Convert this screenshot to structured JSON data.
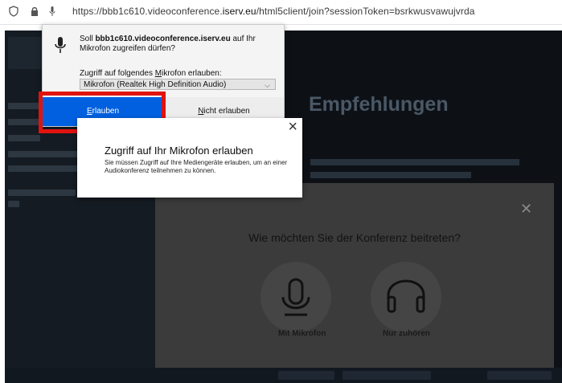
{
  "browser": {
    "url_prefix": "https://bbb1c610.videoconference.",
    "url_domain": "iserv.eu",
    "url_suffix": "/html5client/join?sessionToken=bsrkwusvawujvrda"
  },
  "background": {
    "heading": "Empfehlungen"
  },
  "join_dialog": {
    "title": "Wie möchten Sie der Konferenz beitreten?",
    "options": [
      {
        "label": "Mit Mikrofon",
        "icon": "microphone-icon"
      },
      {
        "label": "Nur zuhören",
        "icon": "headphones-icon"
      }
    ]
  },
  "permission_prompt": {
    "question_prefix": "Soll ",
    "site": "bbb1c610.videoconference.iserv.eu",
    "question_suffix": " auf Ihr Mikrofon zugreifen dürfen?",
    "device_label_pre": "Zugriff auf folgendes ",
    "device_label_u": "M",
    "device_label_post": "ikrofon erlauben:",
    "selected_device": "Mikrofon (Realtek High Definition Audio)",
    "allow_u": "E",
    "allow_rest": "rlauben",
    "deny_u": "N",
    "deny_rest": "icht erlauben"
  },
  "info_popup": {
    "title": "Zugriff auf Ihr Mikrofon erlauben",
    "text": "Sie müssen Zugriff auf Ihre Mediengeräte erlauben, um an einer Audiokonferenz teilnehmen zu können."
  },
  "colors": {
    "allow_button": "#0060df",
    "highlight_box": "#e0130f"
  }
}
